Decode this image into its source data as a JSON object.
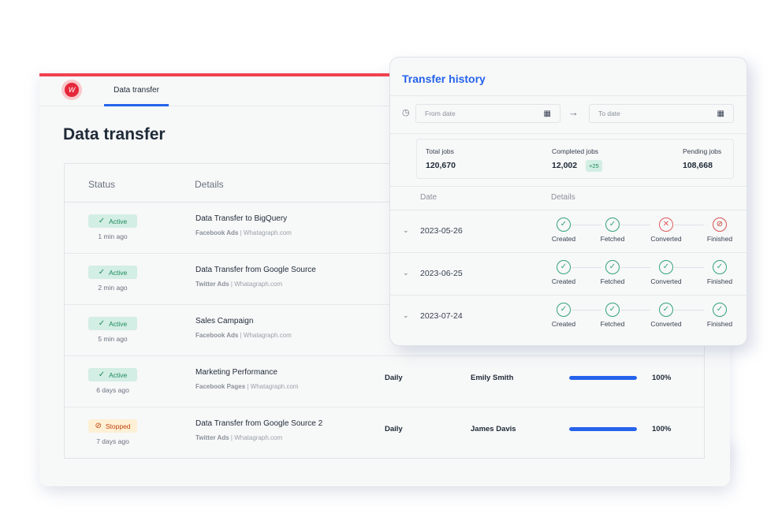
{
  "nav": {
    "logo_glyph": "W",
    "tab_label": "Data transfer"
  },
  "page": {
    "title": "Data transfer"
  },
  "table": {
    "headers": {
      "status": "Status",
      "details": "Details"
    },
    "rows": [
      {
        "status": "Active",
        "status_type": "active",
        "status_icon": "✓",
        "ago": "1 min ago",
        "title": "Data Transfer to BigQuery",
        "source": "Facebook Ads",
        "site": "Whatagraph.com",
        "frequency": "",
        "owner": "",
        "progress": null,
        "progress_label": ""
      },
      {
        "status": "Active",
        "status_type": "active",
        "status_icon": "✓",
        "ago": "2 min ago",
        "title": "Data Transfer from Google Source",
        "source": "Twitter Ads",
        "site": "Whatagraph.com",
        "frequency": "",
        "owner": "",
        "progress": null,
        "progress_label": ""
      },
      {
        "status": "Active",
        "status_type": "active",
        "status_icon": "✓",
        "ago": "5 min ago",
        "title": "Sales Campaign",
        "source": "Facebook Ads",
        "site": "Whatagraph.com",
        "frequency": "",
        "owner": "",
        "progress": null,
        "progress_label": ""
      },
      {
        "status": "Active",
        "status_type": "active",
        "status_icon": "✓",
        "ago": "6 days ago",
        "title": "Marketing Performance",
        "source": "Facebook Pages",
        "site": "Whatagraph.com",
        "frequency": "Daily",
        "owner": "Emily Smith",
        "progress": 100,
        "progress_label": "100%"
      },
      {
        "status": "Stopped",
        "status_type": "stopped",
        "status_icon": "⃠",
        "ago": "7 days ago",
        "title": "Data Transfer from Google Source 2",
        "source": "Twitter Ads",
        "site": "Whatagraph.com",
        "frequency": "Daily",
        "owner": "James Davis",
        "progress": 100,
        "progress_label": "100%"
      }
    ]
  },
  "history": {
    "title": "Transfer history",
    "from_placeholder": "From date",
    "to_placeholder": "To date",
    "stats": {
      "total_label": "Total jobs",
      "total_value": "120,670",
      "completed_label": "Completed jobs",
      "completed_value": "12,002",
      "completed_delta": "+25",
      "pending_label": "Pending jobs",
      "pending_value": "108,668"
    },
    "headers": {
      "date": "Date",
      "details": "Details"
    },
    "rows": [
      {
        "date": "2023-05-26",
        "steps": [
          {
            "label": "Created",
            "state": "done"
          },
          {
            "label": "Fetched",
            "state": "done"
          },
          {
            "label": "Converted",
            "state": "error"
          },
          {
            "label": "Finished",
            "state": "stopped"
          }
        ]
      },
      {
        "date": "2023-06-25",
        "steps": [
          {
            "label": "Created",
            "state": "done"
          },
          {
            "label": "Fetched",
            "state": "done"
          },
          {
            "label": "Converted",
            "state": "done"
          },
          {
            "label": "Finished",
            "state": "done"
          }
        ]
      },
      {
        "date": "2023-07-24",
        "steps": [
          {
            "label": "Created",
            "state": "done"
          },
          {
            "label": "Fetched",
            "state": "done"
          },
          {
            "label": "Converted",
            "state": "done"
          },
          {
            "label": "Finished",
            "state": "done"
          }
        ]
      }
    ]
  },
  "colors": {
    "accent": "#2563eb",
    "brand_red": "#f0424f",
    "success": "#34a37a",
    "error": "#e25c5c"
  }
}
